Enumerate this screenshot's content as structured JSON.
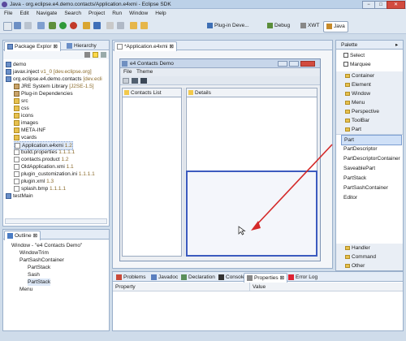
{
  "window": {
    "title": "Java - org.eclipse.e4.demo.contacts/Application.e4xmi - Eclipse SDK",
    "min": "−",
    "max": "□",
    "close": "✕"
  },
  "menu": [
    "File",
    "Edit",
    "Navigate",
    "Search",
    "Project",
    "Run",
    "Window",
    "Help"
  ],
  "perspectives": [
    "Plug-in Deve...",
    "Debug",
    "XWT",
    "Java"
  ],
  "pkg_tabs": {
    "explorer": "Package Explor",
    "hierarchy": "Hierarchy"
  },
  "tree": [
    {
      "label": "demo",
      "deco": ""
    },
    {
      "label": "javax.inject",
      "deco": " v1_0 [dev.eclipse.org]"
    },
    {
      "label": "org.eclipse.e4.demo.contacts",
      "deco": " [dev.ecli"
    },
    {
      "label": "JRE System Library",
      "deco": " [J2SE-1.5]"
    },
    {
      "label": "Plug-in Dependencies",
      "deco": ""
    },
    {
      "label": "src",
      "deco": ""
    },
    {
      "label": "css",
      "deco": ""
    },
    {
      "label": "icons",
      "deco": ""
    },
    {
      "label": "images",
      "deco": ""
    },
    {
      "label": "META-INF",
      "deco": ""
    },
    {
      "label": "vcards",
      "deco": ""
    },
    {
      "label": "Application.e4xmi",
      "deco": " 1.2"
    },
    {
      "label": "build.properties",
      "deco": " 1.1.1.1"
    },
    {
      "label": "contacts.product",
      "deco": " 1.2"
    },
    {
      "label": "OldApplication.xmi",
      "deco": " 1.1"
    },
    {
      "label": "plugin_customization.ini",
      "deco": " 1.1.1.1"
    },
    {
      "label": "plugin.xml",
      "deco": " 1.3"
    },
    {
      "label": "splash.bmp",
      "deco": " 1.1.1.1"
    },
    {
      "label": "testMain",
      "deco": ""
    }
  ],
  "outline": {
    "tab": "Outline",
    "items": [
      "Window - \"e4 Contacts Demo\"",
      "WindowTrim",
      "PartSashContainer",
      "PartStack",
      "Sash",
      "PartStack",
      "Menu"
    ]
  },
  "editor": {
    "tab": "*Application.e4xmi",
    "mock_title": "e4 Contacts Demo",
    "mock_menu": [
      "File",
      "Theme"
    ],
    "contacts_tab": "Contacts List",
    "details_tab": "Details"
  },
  "palette": {
    "title": "Palette",
    "tools": [
      "Select",
      "Marquee"
    ],
    "sections_top": [
      "Container",
      "Element",
      "Window",
      "Menu",
      "Perspective",
      "ToolBar",
      "Part"
    ],
    "part_items": [
      "Part",
      "PartDescriptor",
      "PartDescriptorContainer",
      "SaveablePart",
      "PartStack",
      "PartSashContainer",
      "Editor"
    ],
    "sections_bottom": [
      "Handler",
      "Command",
      "Other"
    ]
  },
  "bottom": {
    "tabs": [
      "Problems",
      "Javadoc",
      "Declaration",
      "Console",
      "Properties",
      "Error Log"
    ],
    "columns": [
      "Property",
      "Value"
    ]
  },
  "colors": {
    "accent": "#3c5bbf",
    "arrow": "#d42a2a"
  }
}
